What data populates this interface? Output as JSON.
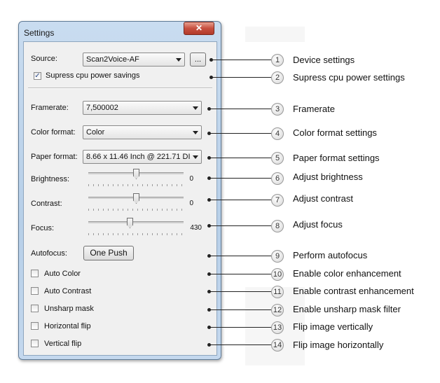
{
  "dialog": {
    "title": "Settings",
    "close_glyph": "✕"
  },
  "source": {
    "label": "Source:",
    "value": "Scan2Voice-AF",
    "browse_label": "..."
  },
  "cpu": {
    "label": "Supress cpu power savings",
    "checked": true,
    "check_glyph": "✓"
  },
  "framerate": {
    "label": "Framerate:",
    "value": "7,500002"
  },
  "color_format": {
    "label": "Color format:",
    "value": "Color"
  },
  "paper_format": {
    "label": "Paper format:",
    "value": "8.66 x 11.46 Inch @ 221.71 DI"
  },
  "brightness": {
    "label": "Brightness:",
    "value": "0",
    "level": 0.5
  },
  "contrast": {
    "label": "Contrast:",
    "value": "0",
    "level": 0.5
  },
  "focus": {
    "label": "Focus:",
    "value": "430",
    "level": 0.43
  },
  "autofocus": {
    "label": "Autofocus:",
    "button": "One Push"
  },
  "options": [
    {
      "label": "Auto Color",
      "checked": false
    },
    {
      "label": "Auto Contrast",
      "checked": false
    },
    {
      "label": "Unsharp mask",
      "checked": false
    },
    {
      "label": "Horizontal flip",
      "checked": false
    },
    {
      "label": "Vertical flip",
      "checked": false
    }
  ],
  "callouts": [
    {
      "n": "1",
      "text": "Device settings"
    },
    {
      "n": "2",
      "text": "Supress cpu power settings"
    },
    {
      "n": "3",
      "text": "Framerate"
    },
    {
      "n": "4",
      "text": "Color format settings"
    },
    {
      "n": "5",
      "text": "Paper format settings"
    },
    {
      "n": "6",
      "text": "Adjust brightness"
    },
    {
      "n": "7",
      "text": "Adjust contrast"
    },
    {
      "n": "8",
      "text": "Adjust focus"
    },
    {
      "n": "9",
      "text": "Perform autofocus"
    },
    {
      "n": "10",
      "text": "Enable color enhancement"
    },
    {
      "n": "11",
      "text": "Enable contrast enhancement"
    },
    {
      "n": "12",
      "text": "Enable unsharp mask filter"
    },
    {
      "n": "13",
      "text": "Flip image vertically"
    },
    {
      "n": "14",
      "text": "Flip image horizontally"
    }
  ]
}
